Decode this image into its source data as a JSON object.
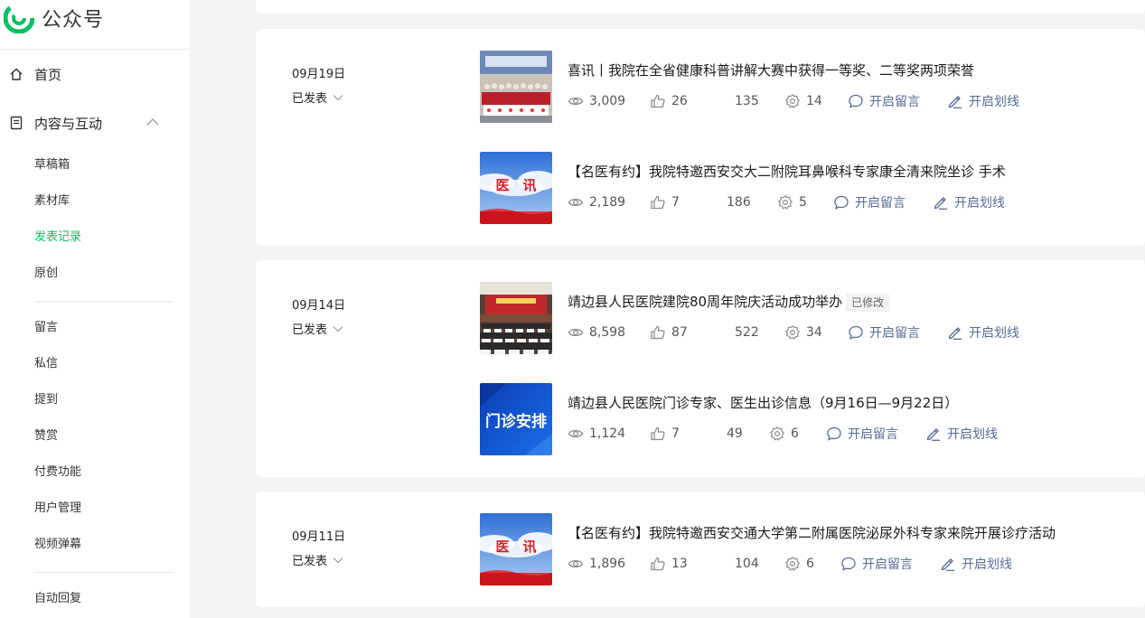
{
  "brand": {
    "name": "公众号",
    "logo_icon": "wechat-mp-logo-icon",
    "color": "#07c160"
  },
  "sidebar": {
    "home": {
      "label": "首页",
      "icon": "home-icon"
    },
    "content": {
      "label": "内容与互动",
      "icon": "document-icon",
      "expanded": true
    },
    "group1": [
      {
        "label": "草稿箱",
        "active": false
      },
      {
        "label": "素材库",
        "active": false
      },
      {
        "label": "发表记录",
        "active": true
      },
      {
        "label": "原创",
        "active": false
      }
    ],
    "group2": [
      {
        "label": "留言"
      },
      {
        "label": "私信"
      },
      {
        "label": "提到"
      },
      {
        "label": "赞赏"
      },
      {
        "label": "付费功能"
      },
      {
        "label": "用户管理"
      },
      {
        "label": "视频弹幕"
      }
    ],
    "group3": [
      {
        "label": "自动回复"
      }
    ]
  },
  "posts": [
    {
      "date": "09月19日",
      "status": "已发表",
      "articles": [
        {
          "title": "喜讯丨我院在全省健康科普讲解大赛中获得一等奖、二等奖两项荣誉",
          "badge": "",
          "views": "3,009",
          "likes": "26",
          "shares": "135",
          "wow": "14",
          "comment_action": "开启留言",
          "underline_action": "开启划线",
          "thumb": "group-photo"
        },
        {
          "title": "【名医有约】我院特邀西安交大二附院耳鼻喉科专家康全清来院坐诊 手术",
          "badge": "",
          "views": "2,189",
          "likes": "7",
          "shares": "186",
          "wow": "5",
          "comment_action": "开启留言",
          "underline_action": "开启划线",
          "thumb": "yixun",
          "thumb_text": "医　讯"
        }
      ]
    },
    {
      "date": "09月14日",
      "status": "已发表",
      "articles": [
        {
          "title": "靖边县人民医院建院80周年院庆活动成功举办",
          "badge": "已修改",
          "views": "8,598",
          "likes": "87",
          "shares": "522",
          "wow": "34",
          "comment_action": "开启留言",
          "underline_action": "开启划线",
          "thumb": "auditorium"
        },
        {
          "title": "靖边县人民医院门诊专家、医生出诊信息（9月16日—9月22日）",
          "badge": "",
          "views": "1,124",
          "likes": "7",
          "shares": "49",
          "wow": "6",
          "comment_action": "开启留言",
          "underline_action": "开启划线",
          "thumb": "menzhen",
          "thumb_text": "门诊安排"
        }
      ]
    },
    {
      "date": "09月11日",
      "status": "已发表",
      "articles": [
        {
          "title": "【名医有约】我院特邀西安交通大学第二附属医院泌尿外科专家来院开展诊疗活动",
          "badge": "",
          "views": "1,896",
          "likes": "13",
          "shares": "104",
          "wow": "6",
          "comment_action": "开启留言",
          "underline_action": "开启划线",
          "thumb": "yixun",
          "thumb_text": "医　讯"
        }
      ]
    }
  ]
}
